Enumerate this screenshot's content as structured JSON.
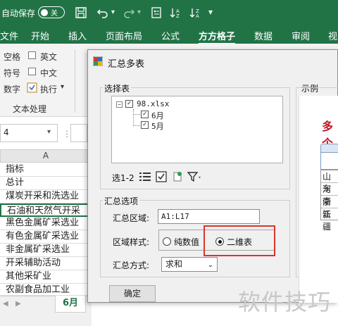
{
  "titlebar": {
    "autosave_label": "自动保存",
    "autosave_state": "关",
    "bg_color": "#217346"
  },
  "ribbon": {
    "tabs": [
      "文件",
      "开始",
      "插入",
      "页面布局",
      "公式",
      "方方格子",
      "数据",
      "审阅",
      "视"
    ],
    "active_tab": "方方格子",
    "group_rows": {
      "row1_left": "空格",
      "row1_right": "英文",
      "row2_left": "符号",
      "row2_right": "中文",
      "row3_left": "数字",
      "row3_right": "执行"
    },
    "group_label": "文本处理"
  },
  "namebox": {
    "value": "4"
  },
  "sheet": {
    "column_header": "A",
    "rows": [
      "指标",
      "总计",
      "煤炭开采和洗选业",
      "石油和天然气开采",
      "黑色金属矿采选业",
      "有色金属矿采选业",
      "非金属矿采选业",
      "开采辅助活动",
      "其他采矿业",
      "农副食品加工业"
    ],
    "active_tab": "6月"
  },
  "dialog": {
    "title": "汇总多表",
    "select_group_label": "选择表",
    "tree": {
      "root": "98.xlsx",
      "children": [
        "6月",
        "5月"
      ]
    },
    "toolbar_label": "选1-2",
    "options_group_label": "汇总选项",
    "range_label": "汇总区域:",
    "range_value": "A1:L17",
    "style_label": "区域样式:",
    "style_option1": "纯数值",
    "style_option2": "二维表",
    "style_selected": "二维表",
    "method_label": "汇总方式:",
    "method_value": "求和",
    "ok_label": "确定",
    "example_label": "示例"
  },
  "example": {
    "heading_fragment": "多个",
    "cells": [
      "山东",
      "河南",
      "浙江",
      "新疆"
    ]
  },
  "watermark": "软件技巧",
  "colors": {
    "highlight_box": "#d9352d",
    "excel_green": "#217346",
    "example_red": "#c0192a"
  }
}
